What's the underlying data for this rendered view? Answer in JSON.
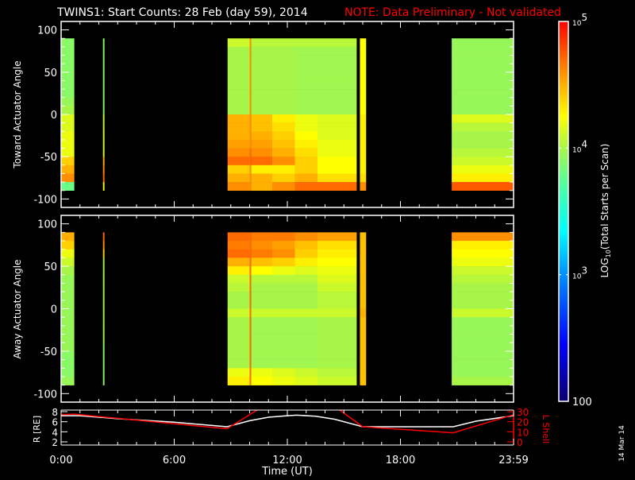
{
  "title": {
    "main": "TWINS1: Start Counts: 28 Feb (day  59), 2014",
    "note": "NOTE: Data Preliminary - Not validated",
    "note_color": "#ff0000"
  },
  "date_stamp": "14 Mar 14",
  "chart_data": [
    {
      "type": "heatmap",
      "ylabel": "Toward Actuator Angle",
      "ylim": [
        -110,
        110
      ],
      "yticks": [
        "100",
        "50",
        "0",
        "-50",
        "-100"
      ],
      "angle_bins_top_to_bottom": [
        90,
        80,
        70,
        60,
        50,
        40,
        30,
        20,
        10,
        0,
        -10,
        -20,
        -30,
        -40,
        -50,
        -60,
        -70,
        -80
      ],
      "columns": [
        {
          "t": [
            0.0,
            0.7
          ],
          "log10": [
            3.9,
            3.9,
            3.9,
            3.9,
            3.9,
            3.9,
            3.9,
            3.95,
            4.0,
            4.15,
            4.15,
            4.2,
            4.2,
            4.2,
            4.4,
            4.5,
            4.6,
            3.8
          ]
        },
        {
          "t": [
            2.22,
            2.3
          ],
          "log10": [
            3.9,
            3.9,
            3.9,
            3.9,
            3.9,
            3.9,
            3.9,
            3.9,
            3.9,
            4.1,
            4.1,
            4.15,
            4.15,
            4.15,
            4.5,
            4.6,
            4.7,
            4.2
          ]
        },
        {
          "t": [
            8.83,
            10.0
          ],
          "log10": [
            4.1,
            4.0,
            4.0,
            4.0,
            4.0,
            4.0,
            4.0,
            4.0,
            4.0,
            4.5,
            4.5,
            4.5,
            4.55,
            4.6,
            4.7,
            4.4,
            4.5,
            4.6
          ]
        },
        {
          "t": [
            10.0,
            10.08
          ],
          "log10": [
            4.6,
            4.6,
            4.6,
            4.6,
            4.6,
            4.6,
            4.6,
            4.6,
            4.6,
            4.6,
            4.6,
            4.6,
            4.6,
            4.7,
            4.7,
            4.6,
            4.6,
            4.6
          ]
        },
        {
          "t": [
            10.08,
            11.2
          ],
          "log10": [
            4.05,
            4.0,
            4.0,
            4.0,
            4.0,
            4.0,
            4.0,
            4.0,
            4.0,
            4.45,
            4.45,
            4.5,
            4.55,
            4.6,
            4.7,
            4.3,
            4.5,
            4.5
          ]
        },
        {
          "t": [
            11.2,
            12.4
          ],
          "log10": [
            4.05,
            4.0,
            4.0,
            4.0,
            4.0,
            4.0,
            4.0,
            4.0,
            4.0,
            4.3,
            4.35,
            4.4,
            4.45,
            4.5,
            4.6,
            4.3,
            4.4,
            4.6
          ]
        },
        {
          "t": [
            12.4,
            13.6
          ],
          "log10": [
            4.05,
            3.98,
            3.98,
            3.98,
            3.98,
            3.98,
            3.98,
            3.98,
            3.98,
            4.2,
            4.2,
            4.25,
            4.3,
            4.35,
            4.4,
            4.4,
            4.5,
            4.7
          ]
        },
        {
          "t": [
            13.6,
            15.68
          ],
          "log10": [
            4.05,
            3.98,
            3.98,
            3.98,
            3.98,
            3.98,
            3.98,
            3.98,
            3.98,
            4.15,
            4.15,
            4.15,
            4.2,
            4.2,
            4.25,
            4.25,
            4.35,
            4.7
          ]
        },
        {
          "t": [
            15.85,
            16.18
          ],
          "log10": [
            4.25,
            4.25,
            4.25,
            4.25,
            4.25,
            4.25,
            4.25,
            4.25,
            4.25,
            4.3,
            4.3,
            4.3,
            4.3,
            4.3,
            4.3,
            4.3,
            4.35,
            4.6
          ]
        },
        {
          "t": [
            20.72,
            24.0
          ],
          "log10": [
            3.95,
            3.95,
            3.95,
            3.95,
            3.95,
            3.95,
            3.95,
            3.95,
            3.95,
            4.15,
            4.05,
            4.0,
            4.0,
            4.05,
            4.1,
            4.2,
            4.3,
            4.75
          ]
        }
      ]
    },
    {
      "type": "heatmap",
      "ylabel": "Away Actuator Angle",
      "ylim": [
        -110,
        110
      ],
      "yticks": [
        "100",
        "50",
        "0",
        "-50",
        "-100"
      ],
      "angle_bins_top_to_bottom": [
        90,
        80,
        70,
        60,
        50,
        40,
        30,
        20,
        10,
        0,
        -10,
        -20,
        -30,
        -40,
        -50,
        -60,
        -70,
        -80
      ],
      "columns": [
        {
          "t": [
            0.0,
            0.7
          ],
          "log10": [
            4.5,
            4.4,
            4.2,
            4.1,
            4.0,
            3.95,
            3.95,
            3.95,
            3.95,
            3.95,
            3.95,
            3.95,
            3.95,
            3.95,
            3.9,
            3.9,
            3.9,
            3.95
          ]
        },
        {
          "t": [
            2.22,
            2.3
          ],
          "log10": [
            4.7,
            4.6,
            4.4,
            3.95,
            3.95,
            3.95,
            3.95,
            3.95,
            3.95,
            3.95,
            3.95,
            3.95,
            3.95,
            3.9,
            3.9,
            3.9,
            3.9,
            3.9
          ]
        },
        {
          "t": [
            8.83,
            10.0
          ],
          "log10": [
            4.7,
            4.65,
            4.7,
            4.5,
            4.3,
            4.1,
            4.05,
            4.0,
            4.0,
            4.1,
            4.0,
            4.0,
            4.0,
            4.0,
            4.0,
            4.0,
            4.2,
            4.3
          ]
        },
        {
          "t": [
            10.0,
            10.08
          ],
          "log10": [
            4.7,
            4.7,
            4.7,
            4.7,
            4.7,
            4.7,
            4.7,
            4.7,
            4.7,
            4.7,
            4.7,
            4.7,
            4.7,
            4.7,
            4.7,
            4.7,
            4.7,
            4.7
          ]
        },
        {
          "t": [
            10.08,
            11.2
          ],
          "log10": [
            4.65,
            4.6,
            4.65,
            4.45,
            4.25,
            4.05,
            4.0,
            4.0,
            4.0,
            4.1,
            3.98,
            3.98,
            3.98,
            3.98,
            3.98,
            3.98,
            4.2,
            4.25
          ]
        },
        {
          "t": [
            11.2,
            12.4
          ],
          "log10": [
            4.65,
            4.55,
            4.6,
            4.4,
            4.2,
            4.05,
            4.0,
            4.0,
            4.0,
            4.1,
            3.98,
            3.98,
            3.98,
            3.98,
            3.98,
            3.98,
            4.15,
            4.2
          ]
        },
        {
          "t": [
            12.4,
            13.6
          ],
          "log10": [
            4.6,
            4.45,
            4.4,
            4.3,
            4.15,
            4.05,
            4.0,
            4.0,
            4.0,
            4.1,
            3.98,
            3.98,
            3.98,
            3.98,
            3.98,
            3.98,
            4.1,
            4.15
          ]
        },
        {
          "t": [
            13.6,
            15.68
          ],
          "log10": [
            4.55,
            4.35,
            4.3,
            4.25,
            4.2,
            4.15,
            4.1,
            4.05,
            4.05,
            4.1,
            4.0,
            4.0,
            4.0,
            4.0,
            4.0,
            4.0,
            4.05,
            4.1
          ]
        },
        {
          "t": [
            15.85,
            16.18
          ],
          "log10": [
            4.45,
            4.45,
            4.45,
            4.45,
            4.45,
            4.45,
            4.45,
            4.45,
            4.45,
            4.5,
            4.45,
            4.45,
            4.45,
            4.45,
            4.45,
            4.45,
            4.45,
            4.45
          ]
        },
        {
          "t": [
            20.72,
            24.0
          ],
          "log10": [
            4.6,
            4.3,
            4.25,
            4.2,
            4.1,
            4.05,
            4.0,
            4.0,
            4.0,
            4.1,
            3.95,
            3.95,
            3.95,
            3.95,
            3.95,
            3.95,
            3.95,
            4.0
          ]
        }
      ]
    },
    {
      "type": "line",
      "xlabel": "Time (UT)",
      "xticks": [
        "0:00",
        "6:00",
        "12:00",
        "18:00",
        "23:59"
      ],
      "xlim": [
        0,
        24
      ],
      "ylabel_left": "R [RE]",
      "ylim_left": [
        2,
        8
      ],
      "yticks_left": [
        "8",
        "6",
        "4",
        "2"
      ],
      "ylabel_right": "L Shell",
      "ylim_right": [
        0,
        30
      ],
      "yticks_right": [
        "30",
        "20",
        "10",
        "0"
      ],
      "series": [
        {
          "axis": "left",
          "color": "#ffffff",
          "x": [
            0,
            1,
            3,
            6,
            8.8,
            10,
            11,
            12,
            12.5,
            13.5,
            14.5,
            16,
            20.8,
            22,
            24
          ],
          "y": [
            7.2,
            7.2,
            6.6,
            5.9,
            5.0,
            6.2,
            6.9,
            7.2,
            7.3,
            7.1,
            6.5,
            5.0,
            5.0,
            6.1,
            7.2
          ]
        },
        {
          "axis": "right",
          "color": "#ff0000",
          "x": [
            0,
            0.7,
            8.8,
            10.6,
            14.6,
            16,
            20.8,
            24
          ],
          "y": [
            27,
            27.5,
            13,
            34,
            34,
            15,
            9,
            27
          ]
        }
      ]
    },
    {
      "type": "colorbar",
      "label": "LOG10(Total Starts per Scan)",
      "label_main": "LOG",
      "label_sub": "10",
      "label_rest": "(Total Starts per Scan)",
      "range_log10": [
        2,
        5
      ],
      "ticks": [
        {
          "base": "10",
          "exp": "5",
          "value": 5
        },
        {
          "base": "10",
          "exp": "4",
          "value": 4
        },
        {
          "base": "10",
          "exp": "3",
          "value": 3
        },
        {
          "base": "100",
          "exp": "",
          "value": 2
        }
      ]
    }
  ]
}
